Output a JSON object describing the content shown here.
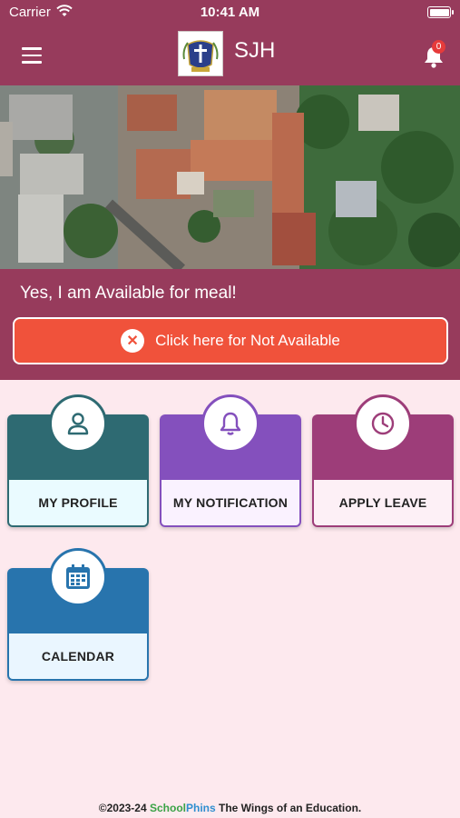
{
  "status_bar": {
    "carrier": "Carrier",
    "time": "10:41 AM"
  },
  "header": {
    "title": "SJH",
    "notification_count": "0"
  },
  "availability": {
    "message": "Yes, I am Available for meal!",
    "button_label": "Click here for Not Available"
  },
  "tiles": [
    {
      "label": "MY PROFILE",
      "icon": "user-icon",
      "color": "#2e6a72"
    },
    {
      "label": "MY NOTIFICATION",
      "icon": "bell-icon",
      "color": "#8450bd"
    },
    {
      "label": "APPLY LEAVE",
      "icon": "clock-icon",
      "color": "#9d3d79"
    },
    {
      "label": "CALENDAR",
      "icon": "calendar-icon",
      "color": "#2874ad"
    }
  ],
  "footer": {
    "copyright": "©2023-24",
    "brand_school": "School",
    "brand_phins": "Phins",
    "tagline": "The Wings of an Education."
  },
  "colors": {
    "primary": "#973b5c",
    "page_bg": "#fde9ee",
    "alert": "#f0523b"
  }
}
